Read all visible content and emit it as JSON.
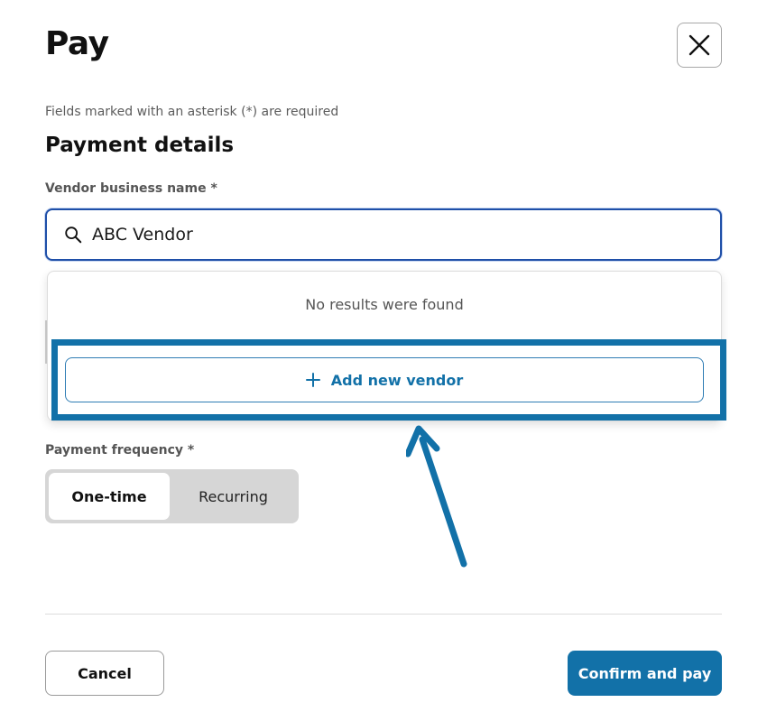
{
  "header": {
    "title": "Pay",
    "close_icon": "close-icon"
  },
  "form": {
    "required_note": "Fields marked with an asterisk (*) are required",
    "section_title": "Payment details",
    "vendor_field": {
      "label": "Vendor business name *",
      "value": "ABC Vendor",
      "icon": "search-icon"
    },
    "dropdown": {
      "no_results": "No results were found",
      "add_vendor_label": "Add new vendor",
      "add_icon": "plus-icon"
    },
    "frequency": {
      "label": "Payment frequency *",
      "options": [
        "One-time",
        "Recurring"
      ],
      "selected": "One-time"
    }
  },
  "footer": {
    "cancel_label": "Cancel",
    "confirm_label": "Confirm and pay"
  },
  "colors": {
    "accent": "#1271a8",
    "input_focus_border": "#1f4fa8",
    "annotation": "#1271a8"
  }
}
